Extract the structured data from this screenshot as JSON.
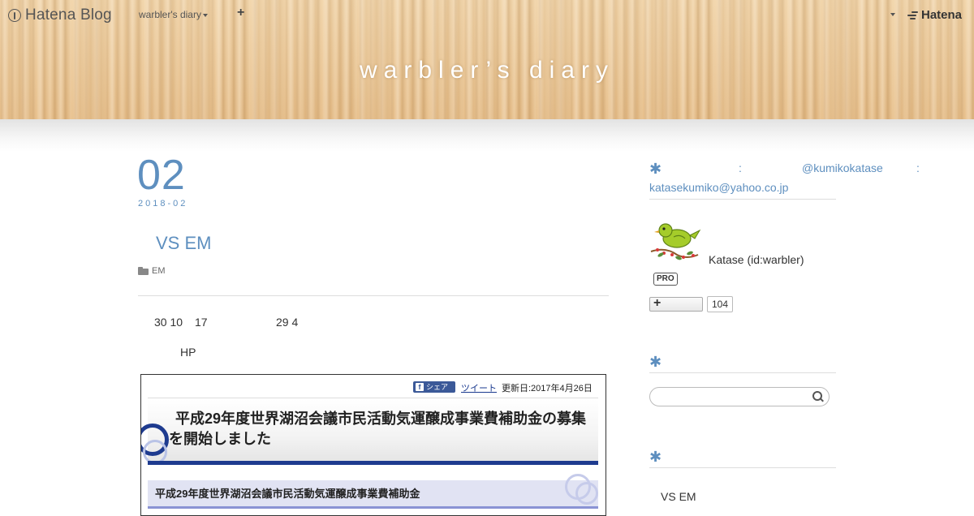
{
  "globalbar": {
    "logo_text": "Hatena Blog",
    "blog_menu_label": "warbler's diary",
    "add_symbol": "+",
    "brand": "Hatena"
  },
  "header": {
    "blog_title": "warbler’s diary"
  },
  "entry": {
    "date_day": "02",
    "date_full": "2018-02",
    "title": "VS EM",
    "category": "EM",
    "paragraph1": [
      "30 10",
      "17",
      "29 4"
    ],
    "paragraph2": "HP",
    "embedded_page": {
      "share_label": "シェア",
      "share_icon": "f",
      "tweet_label": "ツイート",
      "updated": "更新日:2017年4月26日",
      "heading": "平成29年度世界湖沼会議市民活動気運醸成事業費補助金の募集を開始しました",
      "subheading": "平成29年度世界湖沼会議市民活動気運醸成事業費補助金"
    }
  },
  "sidebar": {
    "contact_asterisk": "✱",
    "contact_colon1": ":",
    "contact_twitter": "@kumikokatase",
    "contact_colon2": ":",
    "contact_email": "katasekumiko@yahoo.co.jp",
    "profile_name": "Katase (id:warbler)",
    "pro_badge": "PRO",
    "follow_plus": "+",
    "follow_count": "104",
    "search_asterisk": "✱",
    "recent_asterisk": "✱",
    "recent_entry": "VS EM"
  },
  "colors": {
    "accent": "#5e8fbf",
    "header_wood": "#e9c493",
    "embed_blue": "#1e3b8f"
  }
}
